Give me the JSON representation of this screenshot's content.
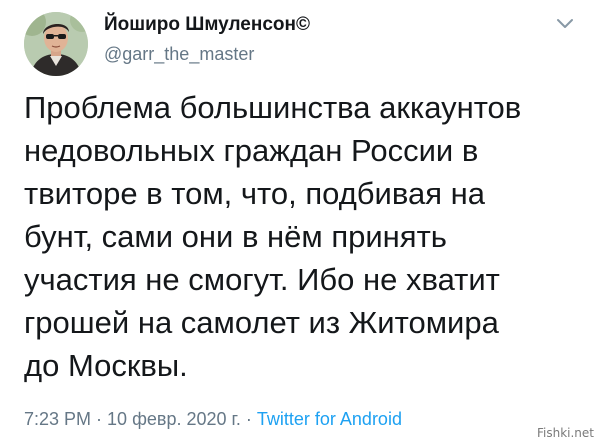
{
  "author": {
    "display_name": "Йоширо Шмуленсон©",
    "handle": "@garr_the_master",
    "avatar": "avatar-photo"
  },
  "menu": {
    "icon": "chevron-down-icon"
  },
  "tweet": {
    "lines": [
      "Проблема большинства аккаунтов",
      "недовольных граждан России в",
      "твиторе в том, что, подбивая на",
      "бунт, сами они в нём принять",
      "участия не смогут. Ибо не хватит",
      "грошей на самолет из Житомира",
      "до Москвы."
    ]
  },
  "meta": {
    "time": "7:23 PM",
    "separator_1": " · ",
    "date": "10 февр. 2020 г.",
    "separator_2": " · ",
    "source": "Twitter for Android"
  },
  "watermark": {
    "text": "Fishki.net"
  },
  "colors": {
    "text": "#14171a",
    "secondary": "#657786",
    "link": "#1da1f2"
  }
}
